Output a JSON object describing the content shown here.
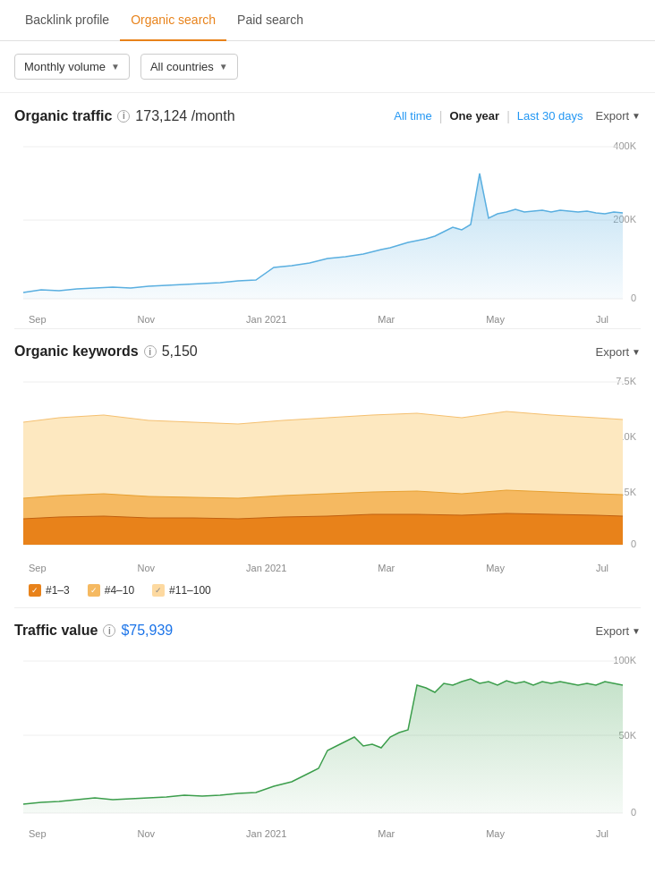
{
  "tabs": [
    {
      "id": "backlink",
      "label": "Backlink profile",
      "active": false
    },
    {
      "id": "organic",
      "label": "Organic search",
      "active": true
    },
    {
      "id": "paid",
      "label": "Paid search",
      "active": false
    }
  ],
  "controls": {
    "volume_dropdown": {
      "label": "Monthly volume",
      "icon": "chevron-down-icon"
    },
    "country_dropdown": {
      "label": "All countries",
      "icon": "chevron-down-icon"
    }
  },
  "organic_traffic": {
    "title": "Organic traffic",
    "value": "173,124 /month",
    "time_filters": [
      {
        "label": "All time",
        "active": false
      },
      {
        "label": "One year",
        "active": true
      },
      {
        "label": "Last 30 days",
        "active": false
      }
    ],
    "export_label": "Export",
    "y_labels": [
      "400K",
      "200K",
      "0"
    ],
    "x_labels": [
      "Sep",
      "Nov",
      "Jan 2021",
      "Mar",
      "May",
      "Jul"
    ]
  },
  "organic_keywords": {
    "title": "Organic keywords",
    "value": "5,150",
    "export_label": "Export",
    "y_labels": [
      "7.5K",
      "5.0K",
      "2.5K",
      "0"
    ],
    "x_labels": [
      "Sep",
      "Nov",
      "Jan 2021",
      "Mar",
      "May",
      "Jul"
    ],
    "legend": [
      {
        "id": "rank1_3",
        "label": "#1–3",
        "color": "#e8821a",
        "checked": true
      },
      {
        "id": "rank4_10",
        "label": "#4–10",
        "color": "#f5b961",
        "checked": true
      },
      {
        "id": "rank11_100",
        "label": "#11–100",
        "color": "#fdd9a0",
        "checked": true
      }
    ]
  },
  "traffic_value": {
    "title": "Traffic value",
    "value": "$75,939",
    "export_label": "Export",
    "y_labels": [
      "100K",
      "50K",
      "0"
    ],
    "x_labels": [
      "Sep",
      "Nov",
      "Jan 2021",
      "Mar",
      "May",
      "Jul"
    ]
  },
  "colors": {
    "blue_line": "#5aafe0",
    "blue_fill": "#ddeef9",
    "orange_dark": "#e8821a",
    "orange_mid": "#f5b961",
    "orange_light": "#fce8c2",
    "green_line": "#3c9e4c",
    "green_fill": "#d6eeda",
    "tab_active": "#e8821a"
  }
}
